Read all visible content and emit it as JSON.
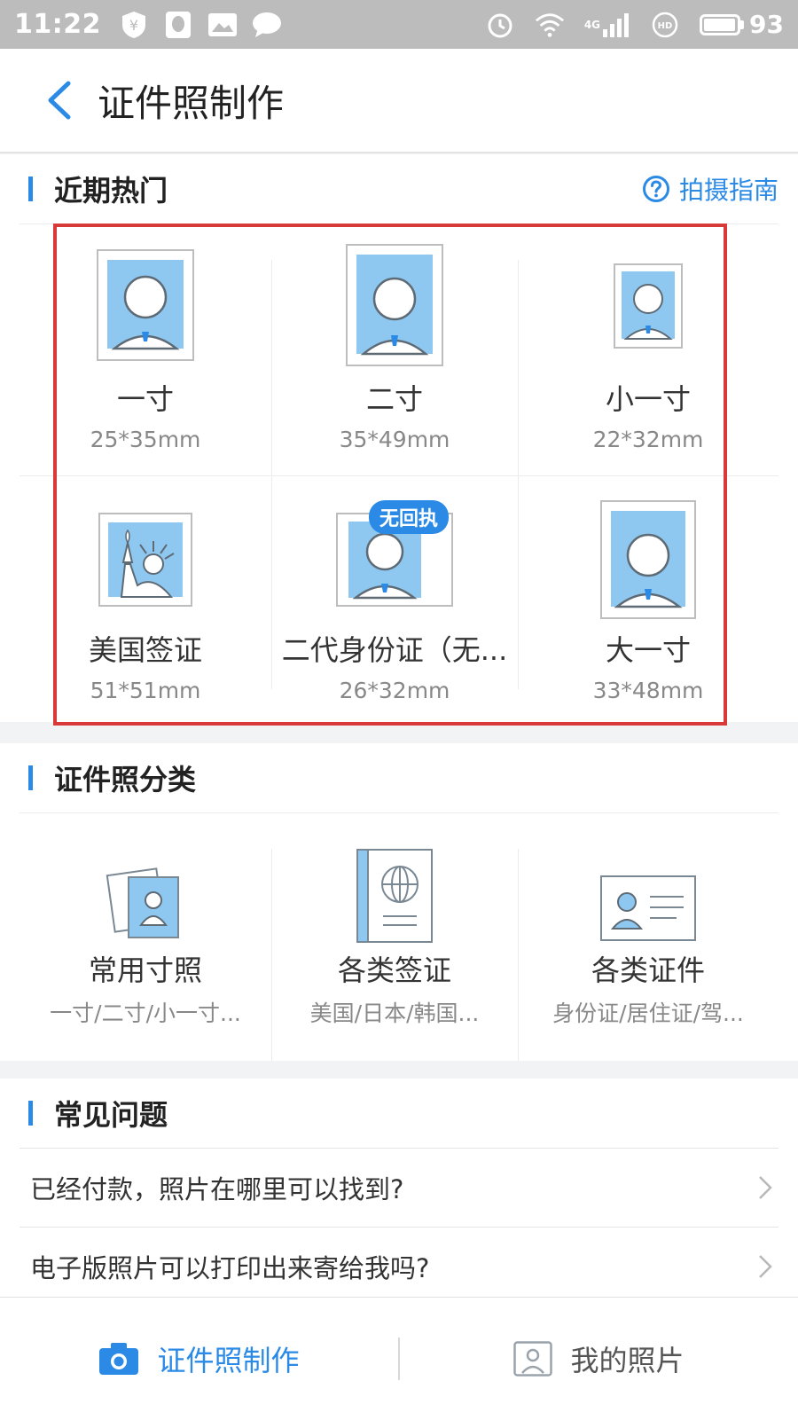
{
  "status_bar": {
    "time": "11:22",
    "network": "4G",
    "battery_percent": "93"
  },
  "header": {
    "title": "证件照制作"
  },
  "recent": {
    "title": "近期热门",
    "guide_label": "拍摄指南",
    "items": [
      {
        "name": "一寸",
        "size": "25*35mm"
      },
      {
        "name": "二寸",
        "size": "35*49mm"
      },
      {
        "name": "小一寸",
        "size": "22*32mm"
      },
      {
        "name": "美国签证",
        "size": "51*51mm"
      },
      {
        "name": "二代身份证（无...",
        "size": "26*32mm",
        "badge": "无回执"
      },
      {
        "name": "大一寸",
        "size": "33*48mm"
      }
    ]
  },
  "categories": {
    "title": "证件照分类",
    "items": [
      {
        "name": "常用寸照",
        "desc": "一寸/二寸/小一寸..."
      },
      {
        "name": "各类签证",
        "desc": "美国/日本/韩国..."
      },
      {
        "name": "各类证件",
        "desc": "身份证/居住证/驾..."
      }
    ]
  },
  "faq": {
    "title": "常见问题",
    "items": [
      {
        "question": "已经付款，照片在哪里可以找到?"
      },
      {
        "question": "电子版照片可以打印出来寄给我吗?"
      }
    ]
  },
  "tabbar": {
    "tabs": [
      {
        "label": "证件照制作",
        "active": true
      },
      {
        "label": "我的照片",
        "active": false
      }
    ]
  },
  "colors": {
    "accent": "#2a8ae6",
    "photo_bg": "#8ec8f0",
    "highlight": "#d83a3a"
  }
}
